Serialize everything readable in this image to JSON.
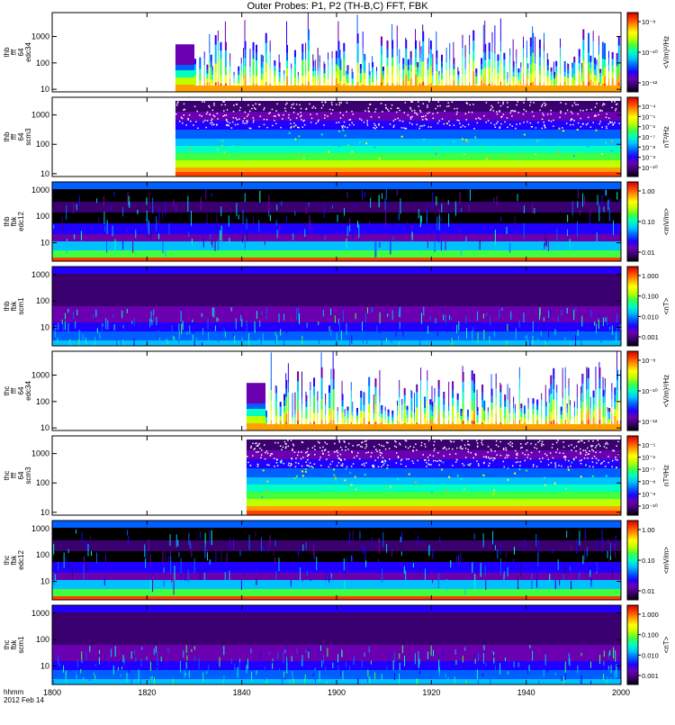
{
  "title": "Outer Probes: P1, P2 (TH-B,C) FFT, FBK",
  "chart_data": [
    {
      "type": "heatmap",
      "probe": "thb",
      "ylabel_lines": [
        "thb",
        "fff",
        "64",
        "edc34"
      ],
      "yscale": "log",
      "ylim": [
        8,
        8000
      ],
      "yticks": [
        "10",
        "100",
        "1000"
      ],
      "colorbar_label": "<V/m)²/Hz",
      "colorbar_ticks": [
        "10⁻⁸",
        "10⁻¹⁰",
        "10⁻¹²"
      ],
      "kind": "fft",
      "data_start_hhmm": 1826,
      "gap_end_hhmm": 1830
    },
    {
      "type": "heatmap",
      "probe": "thb",
      "ylabel_lines": [
        "thb",
        "fff",
        "64",
        "scm3"
      ],
      "yscale": "log",
      "ylim": [
        8,
        4000
      ],
      "yticks": [
        "10",
        "100",
        "1000"
      ],
      "colorbar_label": "nT²/Hz",
      "colorbar_ticks": [
        "10⁻⁴",
        "10⁻⁵",
        "10⁻⁶",
        "10⁻⁷",
        "10⁻⁸",
        "10⁻⁹",
        "10⁻¹⁰"
      ],
      "kind": "scm",
      "data_start_hhmm": 1826,
      "gap_end_hhmm": 1830
    },
    {
      "type": "heatmap",
      "probe": "thb",
      "ylabel_lines": [
        "thb",
        "fbk",
        "edc12"
      ],
      "yscale": "log",
      "ylim": [
        2,
        2000
      ],
      "yticks": [
        "10",
        "100",
        "1000"
      ],
      "colorbar_label": "<mV/m>",
      "colorbar_ticks": [
        "1.00",
        "0.10",
        "0.01"
      ],
      "kind": "fbk_e"
    },
    {
      "type": "heatmap",
      "probe": "thb",
      "ylabel_lines": [
        "thb",
        "fbk",
        "scm1"
      ],
      "yscale": "log",
      "ylim": [
        2,
        2000
      ],
      "yticks": [
        "10",
        "100",
        "1000"
      ],
      "colorbar_label": "<nT>",
      "colorbar_ticks": [
        "1.000",
        "0.100",
        "0.010",
        "0.001"
      ],
      "kind": "fbk_b"
    },
    {
      "type": "heatmap",
      "probe": "thc",
      "ylabel_lines": [
        "thc",
        "fff",
        "64",
        "edc34"
      ],
      "yscale": "log",
      "ylim": [
        8,
        8000
      ],
      "yticks": [
        "10",
        "100",
        "1000"
      ],
      "colorbar_label": "<V/m)²/Hz",
      "colorbar_ticks": [
        "10⁻⁸",
        "10⁻¹⁰",
        "10⁻¹²"
      ],
      "kind": "fft",
      "data_start_hhmm": 1841,
      "gap_end_hhmm": 1845
    },
    {
      "type": "heatmap",
      "probe": "thc",
      "ylabel_lines": [
        "thc",
        "fff",
        "64",
        "scm3"
      ],
      "yscale": "log",
      "ylim": [
        8,
        4000
      ],
      "yticks": [
        "10",
        "100",
        "1000"
      ],
      "colorbar_label": "nT²/Hz",
      "colorbar_ticks": [
        "10⁻⁵",
        "10⁻⁶",
        "10⁻⁷",
        "10⁻⁸",
        "10⁻⁹",
        "10⁻¹⁰"
      ],
      "kind": "scm",
      "data_start_hhmm": 1841,
      "gap_end_hhmm": 1845
    },
    {
      "type": "heatmap",
      "probe": "thc",
      "ylabel_lines": [
        "thc",
        "fbk",
        "edc12"
      ],
      "yscale": "log",
      "ylim": [
        2,
        2000
      ],
      "yticks": [
        "10",
        "100",
        "1000"
      ],
      "colorbar_label": "<mV/m>",
      "colorbar_ticks": [
        "1.00",
        "0.10",
        "0.01"
      ],
      "kind": "fbk_e"
    },
    {
      "type": "heatmap",
      "probe": "thc",
      "ylabel_lines": [
        "thc",
        "fbk",
        "scm1"
      ],
      "yscale": "log",
      "ylim": [
        2,
        2000
      ],
      "yticks": [
        "10",
        "100",
        "1000"
      ],
      "colorbar_label": "<nT>",
      "colorbar_ticks": [
        "1.000",
        "0.100",
        "0.010",
        "0.001"
      ],
      "kind": "fbk_b"
    }
  ],
  "x_axis": {
    "label_top": "hhmm",
    "label_bottom": "2012 Feb 14",
    "xlim": [
      1800,
      2000
    ],
    "ticks": [
      "1800",
      "1820",
      "1840",
      "1900",
      "1920",
      "1940",
      "2000"
    ],
    "tick_positions_hhmm": [
      1800,
      1820,
      1840,
      1900,
      1920,
      1940,
      2000
    ]
  },
  "colormap": [
    "#000000",
    "#3a0070",
    "#6a00b0",
    "#2000ff",
    "#0060ff",
    "#00c0ff",
    "#00ffc0",
    "#40ff40",
    "#c0ff00",
    "#ffff00",
    "#ffa000",
    "#ff4000",
    "#d00000"
  ]
}
